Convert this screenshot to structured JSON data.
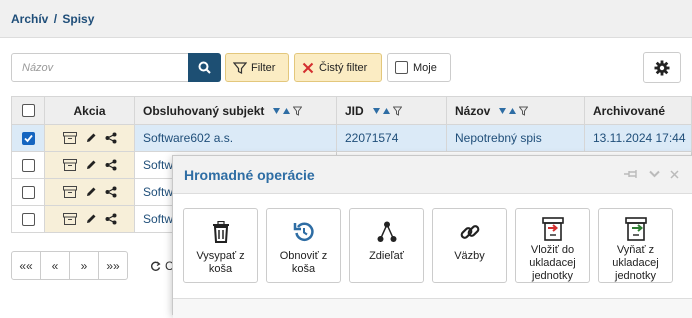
{
  "breadcrumb": {
    "part1": "Archív",
    "sep": "/",
    "part2": "Spisy"
  },
  "toolbar": {
    "search_placeholder": "Názov",
    "filter_label": "Filter",
    "clear_filter_label": "Čistý filter",
    "moje_label": "Moje"
  },
  "table": {
    "headers": [
      "Akcia",
      "Obsluhovaný subjekt",
      "JID",
      "Názov",
      "Archivované"
    ],
    "rows": [
      {
        "subject": "Software602 a.s.",
        "jid": "22071574",
        "name": "Nepotrebný spis",
        "archived": "13.11.2024 17:44",
        "checked": true
      },
      {
        "subject": "Softw",
        "jid": "",
        "name": "",
        "archived": "",
        "checked": false
      },
      {
        "subject": "Softw",
        "jid": "",
        "name": "",
        "archived": "",
        "checked": false
      },
      {
        "subject": "Softw",
        "jid": "",
        "name": "",
        "archived": "",
        "checked": false
      }
    ]
  },
  "pager": {
    "first": "««",
    "prev": "«",
    "next": "»",
    "last": "»»",
    "refresh": "C"
  },
  "modal": {
    "title": "Hromadné operácie",
    "operations": [
      {
        "label": "Vysypať z koša",
        "icon": "trash-icon"
      },
      {
        "label": "Obnoviť z koša",
        "icon": "restore-icon"
      },
      {
        "label": "Zdieľať",
        "icon": "share-icon"
      },
      {
        "label": "Väzby",
        "icon": "link-icon"
      },
      {
        "label": "Vložiť do ukladacej jednotky",
        "icon": "box-in-icon"
      },
      {
        "label": "Vyňať z ukladacej jednotky",
        "icon": "box-out-icon"
      }
    ]
  },
  "colors": {
    "accent": "#1d4f73",
    "link": "#1f4e79",
    "modal_title": "#2e6da4",
    "filter_bg": "#fbecc3",
    "selected_row": "#dbeaf7"
  }
}
